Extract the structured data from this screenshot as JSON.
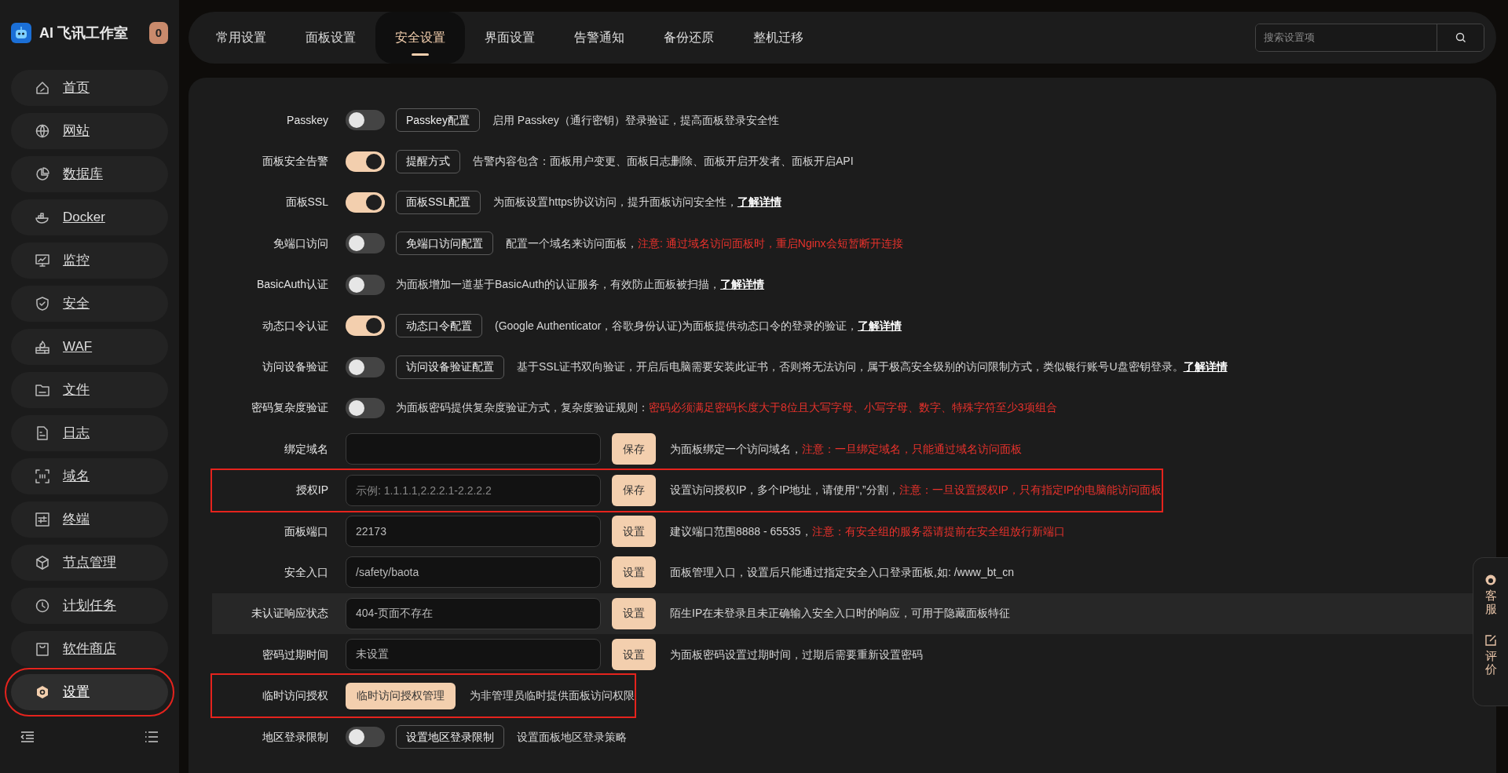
{
  "brand": {
    "title": "AI 飞讯工作室",
    "badge": "0"
  },
  "sidebar": {
    "items": [
      {
        "label": "首页",
        "selected": false,
        "annotated": false
      },
      {
        "label": "网站",
        "selected": false,
        "annotated": false
      },
      {
        "label": "数据库",
        "selected": false,
        "annotated": false
      },
      {
        "label": "Docker",
        "selected": false,
        "annotated": false
      },
      {
        "label": "监控",
        "selected": false,
        "annotated": false
      },
      {
        "label": "安全",
        "selected": false,
        "annotated": false
      },
      {
        "label": "WAF",
        "selected": false,
        "annotated": false
      },
      {
        "label": "文件",
        "selected": false,
        "annotated": false
      },
      {
        "label": "日志",
        "selected": false,
        "annotated": false
      },
      {
        "label": "域名",
        "selected": false,
        "annotated": false
      },
      {
        "label": "终端",
        "selected": false,
        "annotated": false
      },
      {
        "label": "节点管理",
        "selected": false,
        "annotated": false
      },
      {
        "label": "计划任务",
        "selected": false,
        "annotated": false
      },
      {
        "label": "软件商店",
        "selected": false,
        "annotated": false
      },
      {
        "label": "设置",
        "selected": true,
        "annotated": true
      }
    ]
  },
  "tabs": [
    {
      "label": "常用设置",
      "selected": false
    },
    {
      "label": "面板设置",
      "selected": false
    },
    {
      "label": "安全设置",
      "selected": true
    },
    {
      "label": "界面设置",
      "selected": false
    },
    {
      "label": "告警通知",
      "selected": false
    },
    {
      "label": "备份还原",
      "selected": false
    },
    {
      "label": "整机迁移",
      "selected": false
    }
  ],
  "search": {
    "placeholder": "搜索设置项"
  },
  "settings": [
    {
      "kind": "toggle",
      "label": "Passkey",
      "on": false,
      "button": "Passkey配置",
      "description": "启用 Passkey（通行密钥）登录验证，提高面板登录安全性",
      "hovered": false,
      "annotated": false
    },
    {
      "kind": "toggle",
      "label": "面板安全告警",
      "on": true,
      "button": "提醒方式",
      "description": "告警内容包含：面板用户变更、面板日志删除、面板开启开发者、面板开启API",
      "hovered": false,
      "annotated": false
    },
    {
      "kind": "toggle",
      "label": "面板SSL",
      "on": true,
      "button": "面板SSL配置",
      "description": "为面板设置https协议访问，提升面板访问安全性，",
      "link": "了解详情",
      "hovered": false,
      "annotated": false
    },
    {
      "kind": "toggle",
      "label": "免端口访问",
      "on": false,
      "button": "免端口访问配置",
      "description": "配置一个域名来访问面板，",
      "warning": "注意: 通过域名访问面板时，重启Nginx会短暂断开连接",
      "hovered": false,
      "annotated": false
    },
    {
      "kind": "toggle",
      "label": "BasicAuth认证",
      "on": false,
      "description": "为面板增加一道基于BasicAuth的认证服务，有效防止面板被扫描，",
      "link": "了解详情",
      "hovered": false,
      "annotated": false
    },
    {
      "kind": "toggle",
      "label": "动态口令认证",
      "on": true,
      "button": "动态口令配置",
      "description": "(Google Authenticator，谷歌身份认证)为面板提供动态口令的登录的验证，",
      "link": "了解详情",
      "hovered": false,
      "annotated": false
    },
    {
      "kind": "toggle",
      "label": "访问设备验证",
      "on": false,
      "button": "访问设备验证配置",
      "description": "基于SSL证书双向验证，开启后电脑需要安装此证书，否则将无法访问，属于极高安全级别的访问限制方式，类似银行账号U盘密钥登录。",
      "link": "了解详情",
      "hovered": false,
      "annotated": false
    },
    {
      "kind": "toggle",
      "label": "密码复杂度验证",
      "on": false,
      "description": "为面板密码提供复杂度验证方式，复杂度验证规则：",
      "warning": "密码必须满足密码长度大于8位且大写字母、小写字母、数字、特殊字符至少3项组合",
      "hovered": false,
      "annotated": false
    },
    {
      "kind": "input",
      "label": "绑定域名",
      "button": "保存",
      "description": "为面板绑定一个访问域名，",
      "warning": "注意：一旦绑定域名，只能通过域名访问面板",
      "hovered": false,
      "annotated": false
    },
    {
      "kind": "input",
      "label": "授权IP",
      "placeholder": "示例: 1.1.1.1,2.2.2.1-2.2.2.2",
      "button": "保存",
      "description": "设置访问授权IP，多个IP地址，请使用“,”分割，",
      "warning": "注意：一旦设置授权IP，只有指定IP的电脑能访问面板",
      "hovered": false,
      "annotated": true
    },
    {
      "kind": "input",
      "label": "面板端口",
      "value": "22173",
      "button": "设置",
      "description": "建议端口范围8888 - 65535，",
      "warning": "注意：有安全组的服务器请提前在安全组放行新端口",
      "hovered": false,
      "annotated": false
    },
    {
      "kind": "input",
      "label": "安全入口",
      "value": "/safety/baota",
      "button": "设置",
      "description": "面板管理入口，设置后只能通过指定安全入口登录面板,如: /www_bt_cn",
      "hovered": false,
      "annotated": false
    },
    {
      "kind": "input",
      "label": "未认证响应状态",
      "value": "404-页面不存在",
      "button": "设置",
      "description": "陌生IP在未登录且未正确输入安全入口时的响应，可用于隐藏面板特征",
      "hovered": true,
      "annotated": false
    },
    {
      "kind": "input",
      "label": "密码过期时间",
      "value": "未设置",
      "button": "设置",
      "description": "为面板密码设置过期时间，过期后需要重新设置密码",
      "hovered": false,
      "annotated": false
    },
    {
      "kind": "action",
      "label": "临时访问授权",
      "button": "临时访问授权管理",
      "description": "为非管理员临时提供面板访问权限",
      "hovered": false,
      "annotated": true
    },
    {
      "kind": "toggle",
      "label": "地区登录限制",
      "on": false,
      "button": "设置地区登录限制",
      "description": "设置面板地区登录策略",
      "hovered": false,
      "annotated": false
    }
  ],
  "support_panel": {
    "items": [
      "客服",
      "评价"
    ]
  }
}
